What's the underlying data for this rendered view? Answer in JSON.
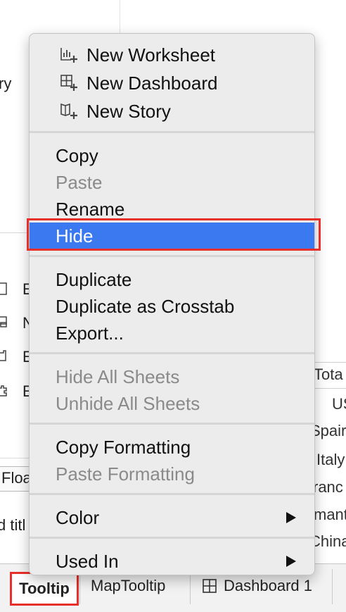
{
  "background": {
    "left_labels": [
      "ry",
      "E",
      "N",
      "E",
      "E"
    ],
    "float_button_label": "Floa",
    "title_fragment": "d titl",
    "right_header": "Tota",
    "right_rows": [
      "US",
      "Spair",
      "Italy",
      "ranc",
      "mant",
      "China"
    ]
  },
  "menu": {
    "new_worksheet": "New Worksheet",
    "new_dashboard": "New Dashboard",
    "new_story": "New Story",
    "copy": "Copy",
    "paste": "Paste",
    "rename": "Rename",
    "hide": "Hide",
    "duplicate": "Duplicate",
    "duplicate_crosstab": "Duplicate as Crosstab",
    "export": "Export...",
    "hide_all_sheets": "Hide All Sheets",
    "unhide_all_sheets": "Unhide All Sheets",
    "copy_formatting": "Copy Formatting",
    "paste_formatting": "Paste Formatting",
    "color": "Color",
    "used_in": "Used In"
  },
  "tabs": {
    "tooltip": "Tooltip",
    "map_tooltip": "MapTooltip",
    "dashboard_1": "Dashboard 1"
  },
  "colors": {
    "highlight": "#3a79ef",
    "annotation_red": "#e8302a"
  }
}
